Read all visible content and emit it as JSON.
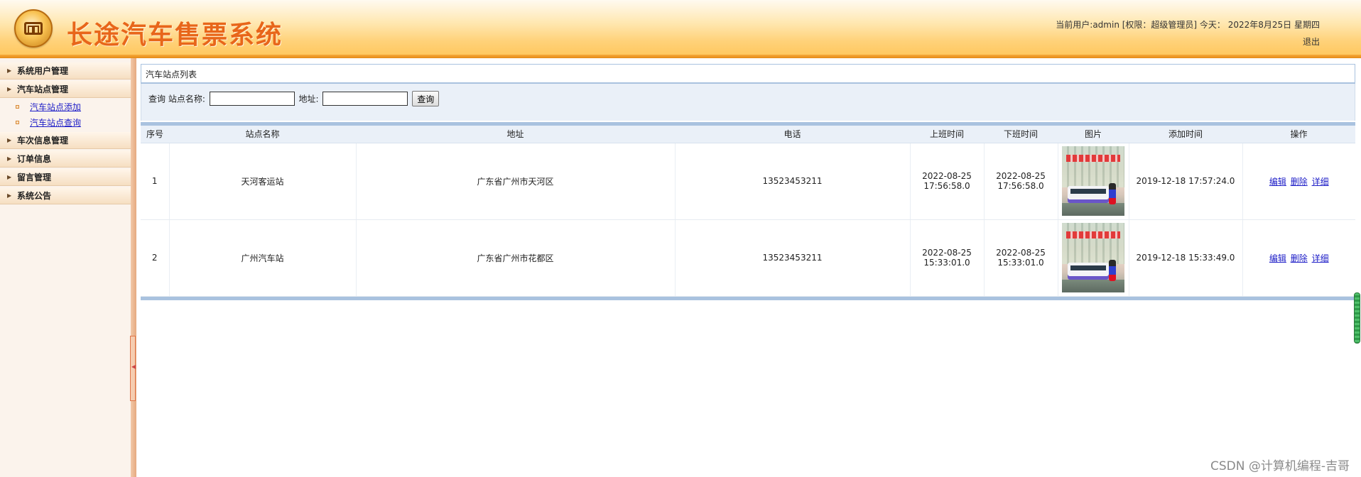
{
  "header": {
    "title": "长途汽车售票系统",
    "user_info": "当前用户:admin [权限：超级管理员] 今天：  2022年8月25日 星期四",
    "logout": "退出"
  },
  "sidebar": {
    "groups": [
      {
        "label": "系统用户管理"
      },
      {
        "label": "汽车站点管理",
        "items": [
          {
            "label": "汽车站点添加"
          },
          {
            "label": "汽车站点查询"
          }
        ]
      },
      {
        "label": "车次信息管理"
      },
      {
        "label": "订单信息"
      },
      {
        "label": "留言管理"
      },
      {
        "label": "系统公告"
      }
    ]
  },
  "panel": {
    "title": "汽车站点列表"
  },
  "search": {
    "query_label": "查询 站点名称:",
    "name_value": "",
    "address_label": "地址:",
    "address_value": "",
    "button": "查询"
  },
  "table": {
    "headers": [
      "序号",
      "站点名称",
      "地址",
      "电话",
      "上班时间",
      "下班时间",
      "图片",
      "添加时间",
      "操作"
    ],
    "rows": [
      {
        "index": "1",
        "name": "天河客运站",
        "address": "广东省广州市天河区",
        "phone": "13523453211",
        "start_time_date": "2022-08-25",
        "start_time_time": "17:56:58.0",
        "end_time_date": "2022-08-25",
        "end_time_time": "17:56:58.0",
        "added": "2019-12-18 17:57:24.0"
      },
      {
        "index": "2",
        "name": "广州汽车站",
        "address": "广东省广州市花都区",
        "phone": "13523453211",
        "start_time_date": "2022-08-25",
        "start_time_time": "15:33:01.0",
        "end_time_date": "2022-08-25",
        "end_time_time": "15:33:01.0",
        "added": "2019-12-18 15:33:49.0"
      }
    ],
    "ops": {
      "edit": "编辑",
      "delete": "删除",
      "detail": "详细"
    }
  },
  "watermark": "CSDN @计算机编程-吉哥",
  "colors": {
    "title": "#e8661a",
    "link": "#2020c8",
    "table_rule": "#a9c2df"
  }
}
